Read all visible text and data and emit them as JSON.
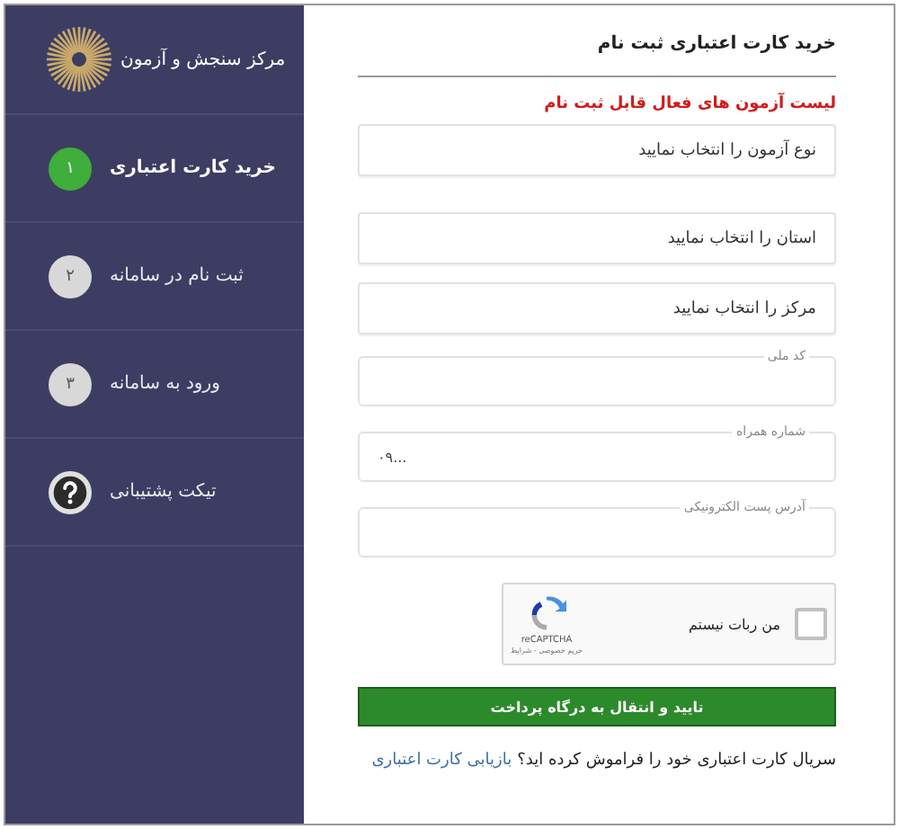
{
  "sidebar": {
    "title": "مرکز سنجش و آزمون",
    "steps": [
      {
        "kind": "number",
        "badge": "۱",
        "label": "خرید کارت اعتباری",
        "selected": true
      },
      {
        "kind": "number",
        "badge": "۲",
        "label": "ثبت نام در سامانه",
        "selected": false
      },
      {
        "kind": "number",
        "badge": "۳",
        "label": "ورود به سامانه",
        "selected": false
      },
      {
        "kind": "help",
        "label": "تیکت پشتیبانی",
        "selected": false
      }
    ]
  },
  "form": {
    "title": "خرید کارت اعتباری ثبت نام",
    "notice": "لیست آزمون های فعال قابل ثبت نام",
    "fields": [
      {
        "kind": "select",
        "placeholder": "نوع آزمون را انتخاب نمایید"
      },
      {
        "kind": "select",
        "placeholder": "استان را انتخاب نمایید"
      },
      {
        "kind": "select",
        "placeholder": "مرکز را انتخاب نمایید"
      },
      {
        "kind": "legend",
        "label": "کد ملی"
      },
      {
        "kind": "legend",
        "label": "شماره همراه",
        "value": "۰۹..."
      },
      {
        "kind": "legend",
        "label": "آدرس پست الکترونیکی"
      }
    ],
    "captcha": {
      "label": "من ربات نیستم",
      "brand": "reCAPTCHA",
      "links": "حریم خصوصی - شرایط",
      "checked": false
    },
    "submit": "تایید و انتقال به درگاه پرداخت",
    "footer": {
      "text": "سریال کارت اعتباری خود را فراموش کرده اید؟",
      "link": "بازیابی کارت اعتباری"
    }
  }
}
